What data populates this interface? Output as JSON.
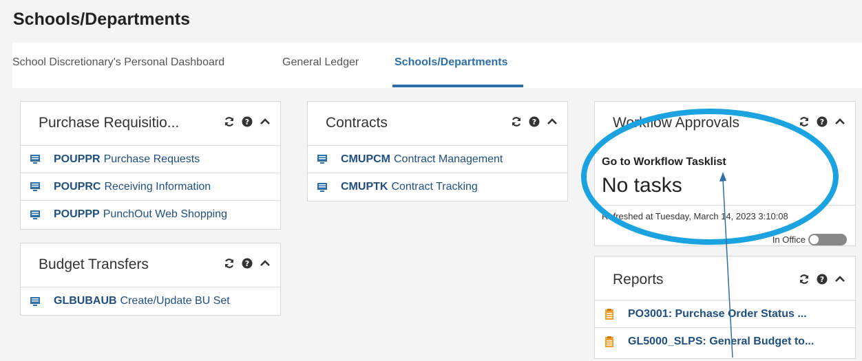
{
  "header": {
    "title": "Schools/Departments"
  },
  "tabs": [
    {
      "label": "School Discretionary's Personal Dashboard"
    },
    {
      "label": "General Ledger"
    },
    {
      "label": "Schools/Departments",
      "active": true
    }
  ],
  "cards": {
    "purchase": {
      "title": "Purchase Requisitio...",
      "items": [
        {
          "code": "POUPPR",
          "desc": "Purchase Requests"
        },
        {
          "code": "POUPRC",
          "desc": "Receiving Information"
        },
        {
          "code": "POUPPP",
          "desc": "PunchOut Web Shopping"
        }
      ]
    },
    "budget": {
      "title": "Budget Transfers",
      "items": [
        {
          "code": "GLBUBAUB",
          "desc": "Create/Update BU Set"
        }
      ]
    },
    "contracts": {
      "title": "Contracts",
      "items": [
        {
          "code": "CMUPCM",
          "desc": "Contract Management"
        },
        {
          "code": "CMUPTK",
          "desc": "Contract Tracking"
        }
      ]
    },
    "workflow": {
      "title": "Workflow Approvals",
      "link": "Go to Workflow Tasklist",
      "status": "No tasks",
      "refreshed": "Refreshed at Tuesday, March 14, 2023 3:10:08",
      "office_label": "In Office",
      "in_office": false
    },
    "reports": {
      "title": "Reports",
      "items": [
        {
          "desc": "PO3001: Purchase Order Status ..."
        },
        {
          "desc": "GL5000_SLPS: General Budget to..."
        }
      ]
    }
  },
  "icons": {
    "refresh": "refresh-icon",
    "help": "help-icon",
    "collapse": "chevron-up-icon",
    "program": "monitor-icon",
    "report": "report-icon"
  },
  "colors": {
    "accent": "#2d6fa8",
    "link": "#1f4f82",
    "report_icon": "#f0a030",
    "annotation": "#1aa3e0"
  }
}
